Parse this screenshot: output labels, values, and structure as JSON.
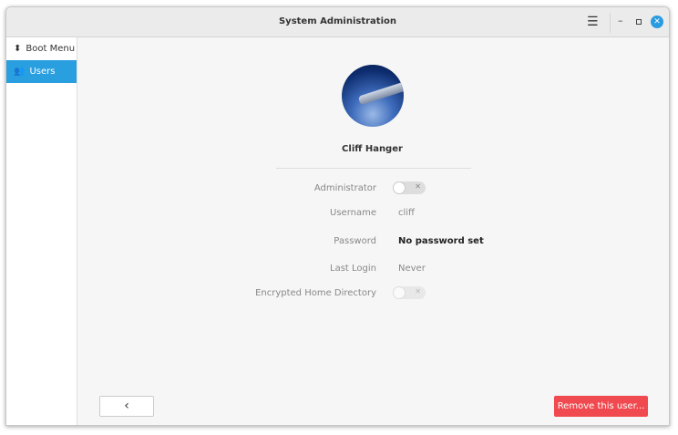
{
  "window": {
    "title": "System Administration"
  },
  "sidebar": {
    "items": [
      {
        "label": "Boot Menu",
        "icon": "chevron-up-down-icon",
        "active": false
      },
      {
        "label": "Users",
        "icon": "users-icon",
        "active": true
      }
    ]
  },
  "user": {
    "full_name": "Cliff Hanger",
    "fields": {
      "administrator_label": "Administrator",
      "administrator_enabled": false,
      "username_label": "Username",
      "username": "cliff",
      "password_label": "Password",
      "password": "No password set",
      "last_login_label": "Last Login",
      "last_login": "Never",
      "encrypted_label": "Encrypted Home Directory",
      "encrypted_enabled": false
    }
  },
  "actions": {
    "back": "‹",
    "remove": "Remove this user..."
  },
  "colors": {
    "accent": "#2a9fe0",
    "danger": "#f0494f"
  }
}
